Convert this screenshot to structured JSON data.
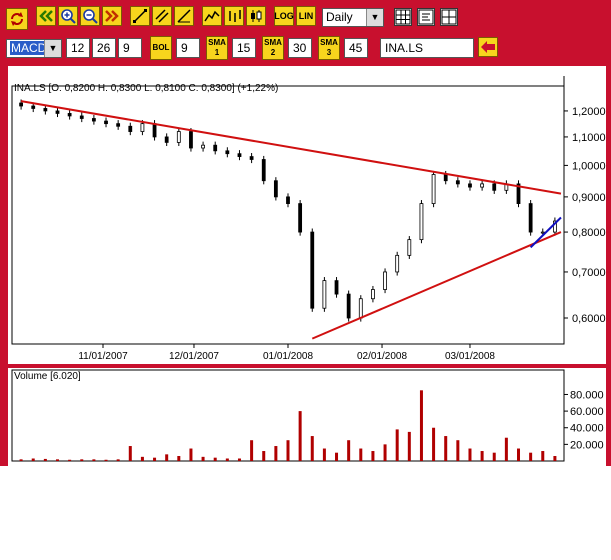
{
  "toolbar": {
    "period_value": "Daily",
    "log_label": "LOG",
    "lin_label": "LIN"
  },
  "indicators": {
    "macd_value": "MACD",
    "macd_fast": "12",
    "macd_slow": "26",
    "macd_signal": "9",
    "bol_label": "BOL",
    "bol_value": "9",
    "sma1_label": "SMA",
    "sma1_num": "1",
    "sma1_value": "15",
    "sma2_label": "SMA",
    "sma2_num": "2",
    "sma2_value": "30",
    "sma3_label": "SMA",
    "sma3_num": "3",
    "sma3_value": "45",
    "symbol_value": "INA.LS"
  },
  "price_chart": {
    "header": "INA.LS [O: 0,8200  H: 0,8300  L: 0,8100  C: 0,8300] (+1,22%)",
    "y_ticks": [
      "1,2000",
      "1,1000",
      "1,0000",
      "0,9000",
      "0,8000",
      "0,7000",
      "0,6000"
    ],
    "x_ticks": [
      "11/01/2007",
      "12/01/2007",
      "01/01/2008",
      "02/01/2008",
      "03/01/2008"
    ]
  },
  "volume_chart": {
    "header": "Volume [6.020]",
    "y_ticks": [
      "80.000",
      "60.000",
      "40.000",
      "20.000"
    ]
  },
  "colors": {
    "frame": "#c8102e",
    "button": "#f7d51d",
    "trendline": "#d01010",
    "support_line": "#1010c0",
    "volume_bar": "#b00000"
  },
  "chart_data": [
    {
      "type": "candlestick",
      "title": "INA.LS [O: 0,8200  H: 0,8300  L: 0,8100  C: 0,8300] (+1,22%)",
      "y_scale": "log",
      "ylim": [
        0.55,
        1.27
      ],
      "x": [
        "2007-10-05",
        "2007-10-09",
        "2007-10-13",
        "2007-10-17",
        "2007-10-21",
        "2007-10-25",
        "2007-10-29",
        "2007-11-02",
        "2007-11-06",
        "2007-11-10",
        "2007-11-14",
        "2007-11-18",
        "2007-11-22",
        "2007-11-26",
        "2007-11-30",
        "2007-12-04",
        "2007-12-08",
        "2007-12-12",
        "2007-12-16",
        "2007-12-20",
        "2007-12-24",
        "2007-12-28",
        "2008-01-01",
        "2008-01-05",
        "2008-01-09",
        "2008-01-13",
        "2008-01-17",
        "2008-01-21",
        "2008-01-25",
        "2008-01-29",
        "2008-02-02",
        "2008-02-06",
        "2008-02-10",
        "2008-02-14",
        "2008-02-18",
        "2008-02-22",
        "2008-02-26",
        "2008-03-01",
        "2008-03-05",
        "2008-03-09",
        "2008-03-13",
        "2008-03-17",
        "2008-03-21",
        "2008-03-25",
        "2008-03-29"
      ],
      "close": [
        1.22,
        1.21,
        1.2,
        1.19,
        1.18,
        1.17,
        1.16,
        1.15,
        1.14,
        1.12,
        1.15,
        1.1,
        1.08,
        1.12,
        1.06,
        1.07,
        1.05,
        1.04,
        1.03,
        1.02,
        0.95,
        0.9,
        0.88,
        0.8,
        0.62,
        0.68,
        0.65,
        0.6,
        0.64,
        0.66,
        0.7,
        0.74,
        0.78,
        0.88,
        0.97,
        0.95,
        0.94,
        0.93,
        0.94,
        0.92,
        0.94,
        0.88,
        0.8,
        0.8,
        0.83
      ],
      "annotations": [
        {
          "type": "trendline",
          "from": [
            "2007-10-05",
            1.24
          ],
          "to": [
            "2008-03-31",
            0.91
          ],
          "color": "#d01010"
        },
        {
          "type": "trendline",
          "from": [
            "2008-01-09",
            0.56
          ],
          "to": [
            "2008-03-31",
            0.8
          ],
          "color": "#d01010"
        },
        {
          "type": "trendline",
          "from": [
            "2008-03-21",
            0.76
          ],
          "to": [
            "2008-03-31",
            0.84
          ],
          "color": "#1010c0"
        }
      ]
    },
    {
      "type": "bar",
      "title": "Volume [6.020]",
      "ylim": [
        0,
        95000
      ],
      "x": [
        "2007-10-05",
        "2007-10-09",
        "2007-10-13",
        "2007-10-17",
        "2007-10-21",
        "2007-10-25",
        "2007-10-29",
        "2007-11-02",
        "2007-11-06",
        "2007-11-10",
        "2007-11-14",
        "2007-11-18",
        "2007-11-22",
        "2007-11-26",
        "2007-11-30",
        "2007-12-04",
        "2007-12-08",
        "2007-12-12",
        "2007-12-16",
        "2007-12-20",
        "2007-12-24",
        "2007-12-28",
        "2008-01-01",
        "2008-01-05",
        "2008-01-09",
        "2008-01-13",
        "2008-01-17",
        "2008-01-21",
        "2008-01-25",
        "2008-01-29",
        "2008-02-02",
        "2008-02-06",
        "2008-02-10",
        "2008-02-14",
        "2008-02-18",
        "2008-02-22",
        "2008-02-26",
        "2008-03-01",
        "2008-03-05",
        "2008-03-09",
        "2008-03-13",
        "2008-03-17",
        "2008-03-21",
        "2008-03-25",
        "2008-03-29"
      ],
      "values": [
        2000,
        3000,
        2500,
        2000,
        1500,
        2000,
        2000,
        1500,
        2000,
        18000,
        5000,
        4000,
        8000,
        6000,
        15000,
        5000,
        4000,
        3000,
        3000,
        25000,
        12000,
        18000,
        25000,
        60000,
        30000,
        15000,
        10000,
        25000,
        15000,
        12000,
        20000,
        38000,
        35000,
        85000,
        40000,
        30000,
        25000,
        15000,
        12000,
        10000,
        28000,
        15000,
        10000,
        12000,
        6000
      ]
    }
  ]
}
